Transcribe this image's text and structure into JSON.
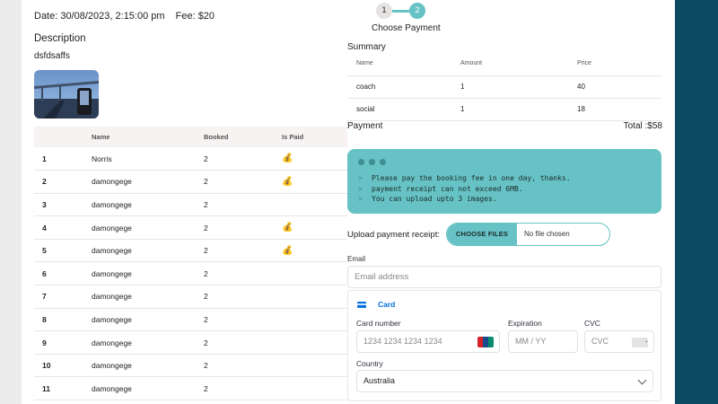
{
  "booking": {
    "date_line": "Date: 30/08/2023, 2:15:00 pm",
    "fee_line": "Fee: $20",
    "description_heading": "Description",
    "description_text": "dsfdsaffs"
  },
  "bookings_table": {
    "headers": [
      "",
      "Name",
      "Booked",
      "Is Paid"
    ],
    "paid_icon": "money-bag-icon",
    "rows": [
      {
        "num": "1",
        "name": "Norris",
        "booked": "2",
        "paid": true
      },
      {
        "num": "2",
        "name": "damongege",
        "booked": "2",
        "paid": true
      },
      {
        "num": "3",
        "name": "damongege",
        "booked": "2",
        "paid": false
      },
      {
        "num": "4",
        "name": "damongege",
        "booked": "2",
        "paid": true
      },
      {
        "num": "5",
        "name": "damongege",
        "booked": "2",
        "paid": true
      },
      {
        "num": "6",
        "name": "damongege",
        "booked": "2",
        "paid": false
      },
      {
        "num": "7",
        "name": "damongege",
        "booked": "2",
        "paid": false
      },
      {
        "num": "8",
        "name": "damongege",
        "booked": "2",
        "paid": false
      },
      {
        "num": "9",
        "name": "damongege",
        "booked": "2",
        "paid": false
      },
      {
        "num": "10",
        "name": "damongege",
        "booked": "2",
        "paid": false
      },
      {
        "num": "11",
        "name": "damongege",
        "booked": "2",
        "paid": false
      }
    ]
  },
  "stepper": {
    "steps": [
      "1",
      "2"
    ],
    "active_step": 2,
    "label": "Choose Payment"
  },
  "summary": {
    "heading": "Summary",
    "headers": [
      "Name",
      "Amount",
      "Price"
    ],
    "rows": [
      {
        "name": "coach",
        "amount": "1",
        "price": "40"
      },
      {
        "name": "social",
        "amount": "1",
        "price": "18"
      }
    ]
  },
  "payment": {
    "label": "Payment",
    "total": "Total :$58"
  },
  "notice": {
    "prompt": ">",
    "lines": [
      "Please pay the booking fee in one day, thanks.",
      "payment receipt can not exceed 6MB.",
      "You can upload upto 3 images."
    ]
  },
  "upload": {
    "label": "Upload payment receipt:",
    "button": "CHOOSE FILES",
    "status": "No file chosen"
  },
  "email": {
    "label": "Email",
    "placeholder": "Email address"
  },
  "card_form": {
    "tab_label": "Card",
    "card_number_label": "Card number",
    "card_number_placeholder": "1234 1234 1234 1234",
    "expiration_label": "Expiration",
    "expiration_placeholder": "MM / YY",
    "cvc_label": "CVC",
    "cvc_placeholder": "CVC",
    "country_label": "Country",
    "country_value": "Australia"
  },
  "colors": {
    "accent": "#66c2c4",
    "sidebar": "#0a4a63",
    "card_blue": "#0570de"
  }
}
